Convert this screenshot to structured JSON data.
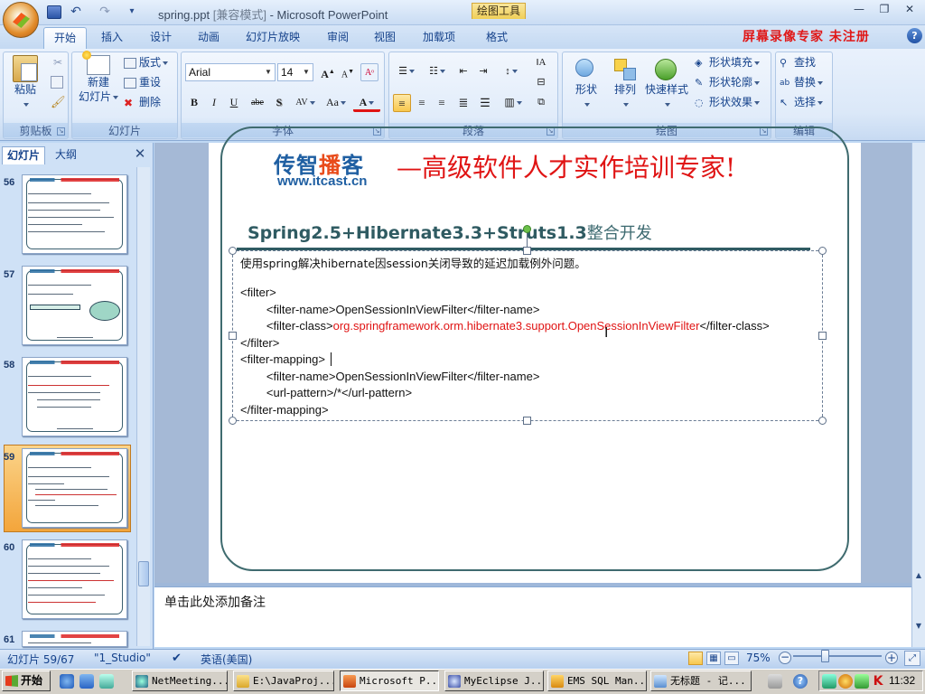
{
  "window": {
    "doc_title": "spring.ppt",
    "compat_mode": "[兼容模式]",
    "app_name": "Microsoft PowerPoint",
    "context_tools_label": "绘图工具",
    "min_symbol": "—",
    "restore_symbol": "❐",
    "close_symbol": "✕"
  },
  "ribbon": {
    "tabs": [
      "开始",
      "插入",
      "设计",
      "动画",
      "幻灯片放映",
      "审阅",
      "视图",
      "加载项",
      "格式"
    ],
    "active_tab": "开始",
    "watermark": "屏幕录像专家  未注册",
    "help": "?",
    "clipboard": {
      "label": "剪贴板",
      "paste": "粘贴"
    },
    "slides": {
      "label": "幻灯片",
      "new_slide_1": "新建",
      "new_slide_2": "幻灯片",
      "layout": "版式",
      "reset": "重设",
      "delete": "删除"
    },
    "font": {
      "label": "字体",
      "name": "Arial",
      "size": "14",
      "grow": "A",
      "shrink": "A",
      "bold": "B",
      "italic": "I",
      "underline": "U",
      "strike": "abe",
      "shadow": "S",
      "spacing": "AV",
      "case": "Aa",
      "color": "A"
    },
    "paragraph": {
      "label": "段落"
    },
    "drawing": {
      "label": "绘图",
      "shapes": "形状",
      "arrange": "排列",
      "quick_styles": "快速样式",
      "fill": "形状填充",
      "outline": "形状轮廓",
      "effects": "形状效果"
    },
    "editing": {
      "label": "编辑",
      "find": "查找",
      "replace": "替换",
      "select": "选择"
    }
  },
  "left_pane": {
    "tab_slides": "幻灯片",
    "tab_outline": "大纲",
    "close": "✕",
    "thumbnails": [
      {
        "num": "56",
        "selected": false
      },
      {
        "num": "57",
        "selected": false
      },
      {
        "num": "58",
        "selected": false
      },
      {
        "num": "59",
        "selected": true
      },
      {
        "num": "60",
        "selected": false
      },
      {
        "num": "61",
        "selected": false
      }
    ]
  },
  "slide": {
    "logo_cn_1": "传智",
    "logo_cn_2": "播",
    "logo_cn_3": "客",
    "logo_url": "www.itcast.cn",
    "slogan": "—高级软件人才实作培训专家!",
    "subtitle_en": "Spring2.5+Hibernate3.3+Struts1.3",
    "subtitle_zh": "整合开发",
    "intro": "使用spring解决hibernate因session关闭导致的延迟加载例外问题。",
    "code": {
      "l1": "<filter>",
      "l2": "        <filter-name>OpenSessionInViewFilter</filter-name>",
      "l3_a": "        <filter-class>",
      "l3_b": "org.springframework.orm.hibernate3.support.OpenSessionInViewFilter",
      "l3_c": "</filter-class>",
      "l4": "</filter>",
      "l5": "<filter-mapping>",
      "l6": "        <filter-name>OpenSessionInViewFilter</filter-name>",
      "l7": "        <url-pattern>/*</url-pattern>",
      "l8": "</filter-mapping>"
    }
  },
  "notes": {
    "placeholder": "单击此处添加备注"
  },
  "status_bar": {
    "slide_info": "幻灯片 59/67",
    "theme": "\"1_Studio\"",
    "language": "英语(美国)",
    "zoom": "75%",
    "zoom_level": 0.5
  },
  "taskbar": {
    "start": "开始",
    "tasks": [
      "NetMeeting...",
      "E:\\JavaProj...",
      "Microsoft P...",
      "MyEclipse J...",
      "EMS SQL Man...",
      "无标题 - 记..."
    ],
    "active_task": "Microsoft P...",
    "clock": "11:32"
  },
  "colors": {
    "accent": "#15428b",
    "red_text": "#e01414",
    "slide_teal": "#2f5b62",
    "logo_blue": "#1f5fa2"
  }
}
